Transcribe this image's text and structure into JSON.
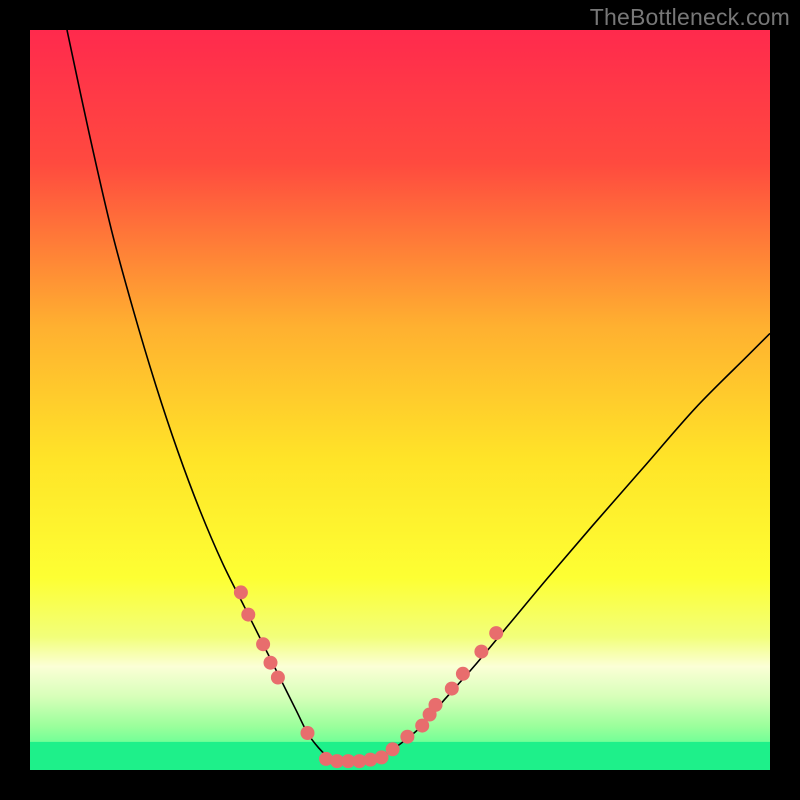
{
  "watermark": "TheBottleneck.com",
  "chart_data": {
    "type": "line",
    "title": "",
    "xlabel": "",
    "ylabel": "",
    "xlim": [
      0,
      100
    ],
    "ylim": [
      0,
      100
    ],
    "background_gradient": [
      {
        "offset": 0.0,
        "color": "#ff2a4d"
      },
      {
        "offset": 0.18,
        "color": "#ff4a3f"
      },
      {
        "offset": 0.4,
        "color": "#ffb030"
      },
      {
        "offset": 0.58,
        "color": "#ffe428"
      },
      {
        "offset": 0.74,
        "color": "#fdff33"
      },
      {
        "offset": 0.82,
        "color": "#f2ff7a"
      },
      {
        "offset": 0.86,
        "color": "#fbffd6"
      },
      {
        "offset": 0.9,
        "color": "#d8ffba"
      },
      {
        "offset": 0.94,
        "color": "#9cff9c"
      },
      {
        "offset": 1.0,
        "color": "#2cff8e"
      }
    ],
    "green_strip": {
      "y_top": 96.2,
      "y_bottom": 100,
      "color": "#1ef08a"
    },
    "series": [
      {
        "name": "bottleneck-curve",
        "color": "#000000",
        "x": [
          5,
          8,
          11,
          14,
          17,
          20,
          23,
          26,
          29,
          32,
          34,
          36,
          37.5,
          39,
          40.5,
          42,
          44,
          47,
          50,
          53,
          56,
          60,
          65,
          70,
          76,
          83,
          90,
          97,
          100
        ],
        "y": [
          100,
          86,
          73,
          62,
          52,
          43,
          35,
          28,
          22,
          16,
          12,
          8,
          5,
          3,
          1.6,
          1.2,
          1.2,
          1.6,
          3.5,
          6,
          9.5,
          14,
          20,
          26,
          33,
          41,
          49,
          56,
          59
        ]
      }
    ],
    "markers": {
      "color": "#e86d6d",
      "radius": 7,
      "points": [
        {
          "x": 28.5,
          "y": 24
        },
        {
          "x": 29.5,
          "y": 21
        },
        {
          "x": 31.5,
          "y": 17
        },
        {
          "x": 32.5,
          "y": 14.5
        },
        {
          "x": 33.5,
          "y": 12.5
        },
        {
          "x": 37.5,
          "y": 5
        },
        {
          "x": 40,
          "y": 1.5
        },
        {
          "x": 41.5,
          "y": 1.2
        },
        {
          "x": 43,
          "y": 1.2
        },
        {
          "x": 44.5,
          "y": 1.2
        },
        {
          "x": 46,
          "y": 1.4
        },
        {
          "x": 47.5,
          "y": 1.7
        },
        {
          "x": 49,
          "y": 2.8
        },
        {
          "x": 51,
          "y": 4.5
        },
        {
          "x": 53,
          "y": 6
        },
        {
          "x": 54,
          "y": 7.5
        },
        {
          "x": 54.8,
          "y": 8.8
        },
        {
          "x": 57,
          "y": 11
        },
        {
          "x": 58.5,
          "y": 13
        },
        {
          "x": 61,
          "y": 16
        },
        {
          "x": 63,
          "y": 18.5
        }
      ]
    }
  }
}
